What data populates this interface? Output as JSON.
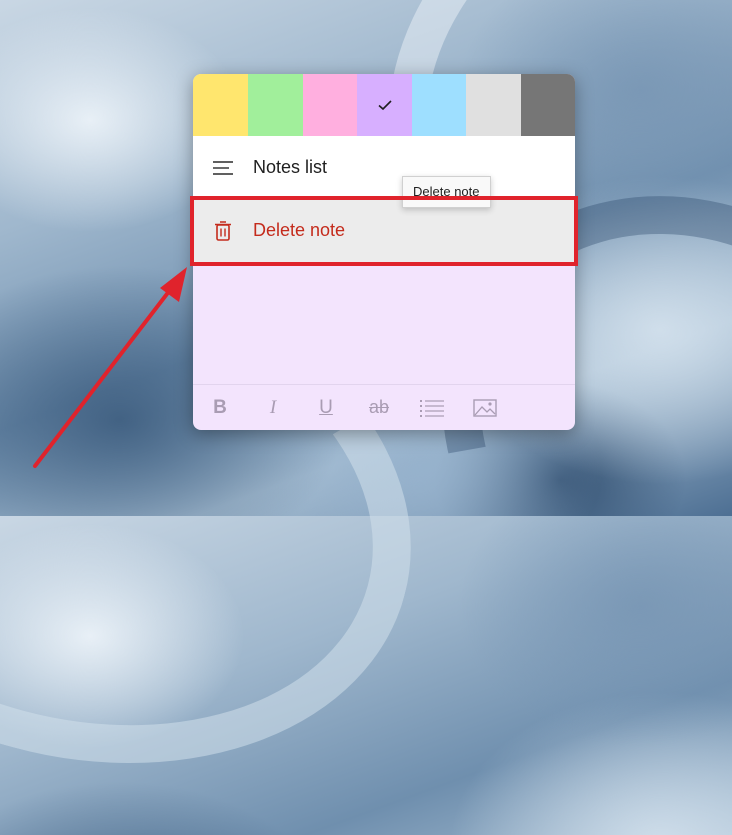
{
  "color_swatches": [
    {
      "name": "yellow",
      "color": "#ffe66e",
      "selected": false
    },
    {
      "name": "green",
      "color": "#a1ef9b",
      "selected": false
    },
    {
      "name": "pink",
      "color": "#ffafdf",
      "selected": false
    },
    {
      "name": "purple",
      "color": "#d7afff",
      "selected": true
    },
    {
      "name": "blue",
      "color": "#9edfff",
      "selected": false
    },
    {
      "name": "gray",
      "color": "#e0e0e0",
      "selected": false
    },
    {
      "name": "charcoal",
      "color": "#767676",
      "selected": false
    }
  ],
  "menu": {
    "notes_list_label": "Notes list",
    "notes_list_icon": "hamburger-icon",
    "delete_note_label": "Delete note",
    "delete_note_icon": "trash-icon"
  },
  "tooltip": {
    "text": "Delete note"
  },
  "format_toolbar": {
    "bold": "B",
    "italic": "I",
    "underline": "U",
    "strikethrough": "ab",
    "list_icon": "bulleted-list-icon",
    "image_icon": "image-icon"
  },
  "annotation": {
    "highlight_color": "#e0232c",
    "arrow_color": "#e0232c"
  },
  "note_background": "#f3e4fd"
}
